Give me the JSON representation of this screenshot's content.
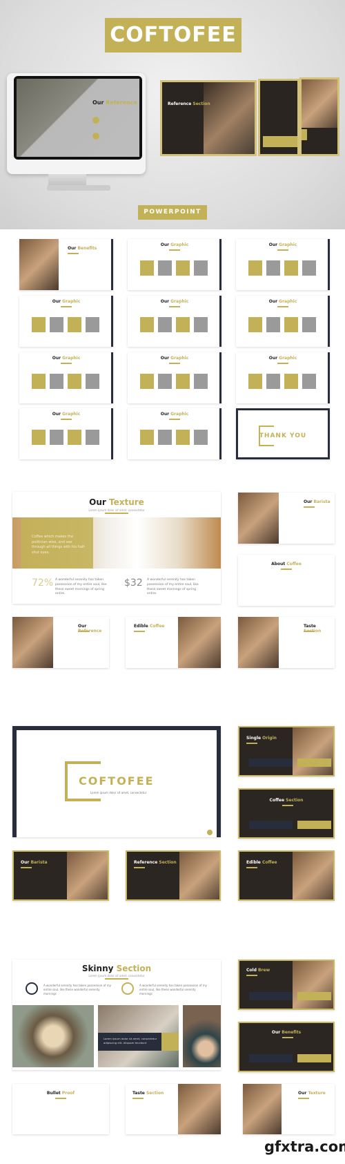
{
  "hero": {
    "title": "COFTOFEE",
    "button": "POWERPOINT",
    "monitor_slide": {
      "dark": "Our",
      "accent": "Reference"
    },
    "floating_slide": {
      "dark": "Reference",
      "accent": "Section"
    }
  },
  "colors": {
    "accent": "#c3b158",
    "navy": "#272d3a",
    "background": "#ffffff"
  },
  "grid_slides": [
    {
      "dark": "Our",
      "accent": "Benefits"
    },
    {
      "dark": "Our",
      "accent": "Graphic"
    },
    {
      "dark": "Our",
      "accent": "Graphic"
    },
    {
      "dark": "Our",
      "accent": "Graphic"
    },
    {
      "dark": "Our",
      "accent": "Graphic"
    },
    {
      "dark": "Our",
      "accent": "Graphic"
    },
    {
      "dark": "Our",
      "accent": "Graphic"
    },
    {
      "dark": "Our",
      "accent": "Graphic"
    },
    {
      "dark": "Our",
      "accent": "Graphic"
    },
    {
      "dark": "Our",
      "accent": "Graphic"
    },
    {
      "dark": "Our",
      "accent": "Graphic"
    },
    {
      "dark": "THANK YOU",
      "accent": ""
    }
  ],
  "texture": {
    "dark": "Our",
    "accent": "Texture",
    "subtitle": "Lorem ipsum dolor sit amet, consectetur",
    "quote": "Coffee which makes the politician wise, and see through all things with his half-shut eyes.",
    "stat1": "72%",
    "stat2": "$32",
    "stat_text": "A wonderful serenity has taken possession of my entire soul, like these sweet mornings of spring entire."
  },
  "section2_small": [
    {
      "dark": "Our",
      "accent": "Barista"
    },
    {
      "dark": "About",
      "accent": "Coffee"
    },
    {
      "dark": "Our",
      "accent": "Reference"
    },
    {
      "dark": "Edible",
      "accent": "Coffee"
    },
    {
      "dark": "Taste",
      "accent": "Section"
    }
  ],
  "cover": {
    "title": "COFTOFEE",
    "subtitle": "Lorem ipsum dolor sit amet, consectetur"
  },
  "section3_small": [
    {
      "dark": "Single",
      "accent": "Origin"
    },
    {
      "dark": "Coffee",
      "accent": "Section"
    },
    {
      "dark": "Our",
      "accent": "Barista"
    },
    {
      "dark": "Reference",
      "accent": "Section"
    },
    {
      "dark": "Edible",
      "accent": "Coffee"
    }
  ],
  "skinny": {
    "dark": "Skinny",
    "accent": "Section",
    "subtitle": "Lorem ipsum dolor sit amet, consectetur",
    "text": "A wonderful serenity has taken possession of my entire soul, like these wonderful serenity mornings",
    "caption": "Lorem ipsum dolor sit amet, consectetur adipiscing elit. Aliquam tincidunt"
  },
  "section4_small": [
    {
      "dark": "Cold",
      "accent": "Brew"
    },
    {
      "dark": "Our",
      "accent": "Benefits"
    },
    {
      "dark": "Bullet",
      "accent": "Proof"
    },
    {
      "dark": "Taste",
      "accent": "Section"
    },
    {
      "dark": "Our",
      "accent": "Texture"
    }
  ],
  "watermark": "gfxtra.com"
}
